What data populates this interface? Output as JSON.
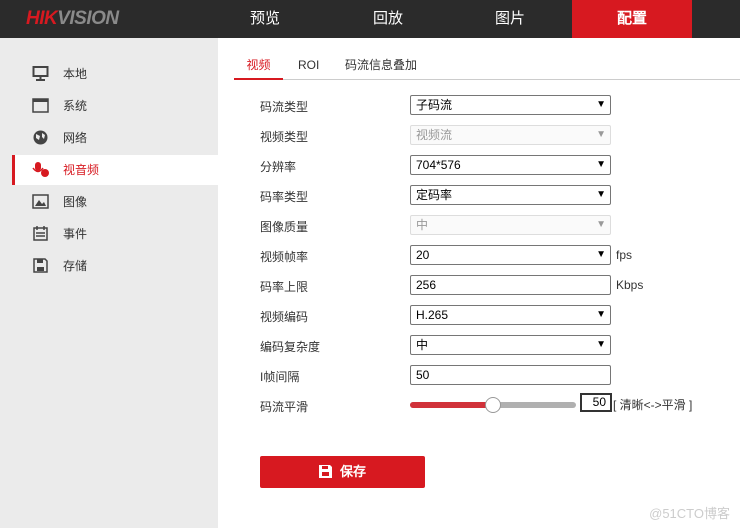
{
  "logo": {
    "red": "HIK",
    "gray": "VISION"
  },
  "nav": [
    "预览",
    "回放",
    "图片",
    "配置"
  ],
  "sidebar": [
    "本地",
    "系统",
    "网络",
    "视音频",
    "图像",
    "事件",
    "存储"
  ],
  "tabs": [
    "视频",
    "ROI",
    "码流信息叠加"
  ],
  "form": {
    "stream_type": {
      "label": "码流类型",
      "value": "子码流"
    },
    "video_type": {
      "label": "视频类型",
      "value": "视频流"
    },
    "resolution": {
      "label": "分辨率",
      "value": "704*576"
    },
    "bitrate_type": {
      "label": "码率类型",
      "value": "定码率"
    },
    "image_quality": {
      "label": "图像质量",
      "value": "中"
    },
    "frame_rate": {
      "label": "视频帧率",
      "value": "20",
      "unit": "fps"
    },
    "max_bitrate": {
      "label": "码率上限",
      "value": "256",
      "unit": "Kbps"
    },
    "encoding": {
      "label": "视频编码",
      "value": "H.265"
    },
    "complexity": {
      "label": "编码复杂度",
      "value": "中"
    },
    "i_frame": {
      "label": "I帧间隔",
      "value": "50"
    },
    "smoothing": {
      "label": "码流平滑",
      "value": "50",
      "percent": 50,
      "hint": "[ 清晰<->平滑 ]"
    }
  },
  "save_label": "保存",
  "watermark": "@51CTO博客",
  "colors": {
    "accent": "#d71920",
    "topbar": "#2b2b2b"
  }
}
